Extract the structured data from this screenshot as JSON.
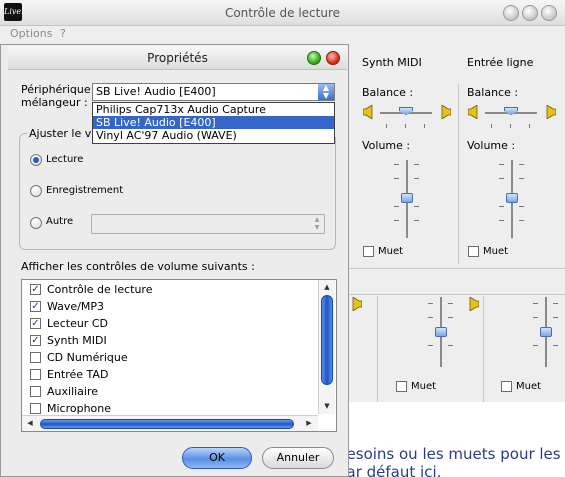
{
  "background_window": {
    "title": "Contrôle de lecture",
    "logo_text": "Live!",
    "menu": [
      "Options",
      "?"
    ],
    "columns": [
      {
        "title": "Synth MIDI",
        "balance_label": "Balance :",
        "volume_label": "Volume :",
        "mute_label": "Muet",
        "muted": false
      },
      {
        "title": "Entrée ligne",
        "balance_label": "Balance :",
        "volume_label": "Volume :",
        "mute_label": "Muet",
        "muted": false
      }
    ],
    "lower_row": [
      {
        "mute_label": "Muet",
        "muted": false
      },
      {
        "mute_label": "Muet",
        "muted": false
      }
    ],
    "help_text_line1": "besoins ou les muets pour les so",
    "help_text_line2": "par défaut ici."
  },
  "dialog": {
    "title": "Propriétés",
    "device_label": "Périphérique mélangeur :",
    "device_selected": "SB Live! Audio [E400]",
    "device_options": [
      "Philips Cap713x Audio Capture",
      "SB Live! Audio [E400]",
      "Vinyl AC'97 Audio (WAVE)"
    ],
    "device_options_selected_index": 1,
    "adjust_group_label": "Ajuster le volu",
    "radios": [
      {
        "label": "Lecture",
        "checked": true
      },
      {
        "label": "Enregistrement",
        "checked": false
      },
      {
        "label": "Autre",
        "checked": false
      }
    ],
    "show_controls_label": "Afficher les contrôles de volume suivants :",
    "controls": [
      {
        "label": "Contrôle de lecture",
        "checked": true
      },
      {
        "label": "Wave/MP3",
        "checked": true
      },
      {
        "label": "Lecteur CD",
        "checked": true
      },
      {
        "label": "Synth MIDI",
        "checked": true
      },
      {
        "label": "CD Numérique",
        "checked": false
      },
      {
        "label": "Entrée TAD",
        "checked": false
      },
      {
        "label": "Auxiliaire",
        "checked": false
      },
      {
        "label": "Microphone",
        "checked": false
      }
    ],
    "ok_label": "OK",
    "cancel_label": "Annuler"
  },
  "icons": {
    "close": "close-icon",
    "minimize": "minimize-icon",
    "maximize": "maximize-icon",
    "speaker": "speaker-icon",
    "dropdown": "chevron-updown-icon"
  },
  "colors": {
    "accent_blue": "#3465c8",
    "help_text": "#2a3b88",
    "close_red": "#e0301f",
    "zoom_green": "#34b01b"
  }
}
